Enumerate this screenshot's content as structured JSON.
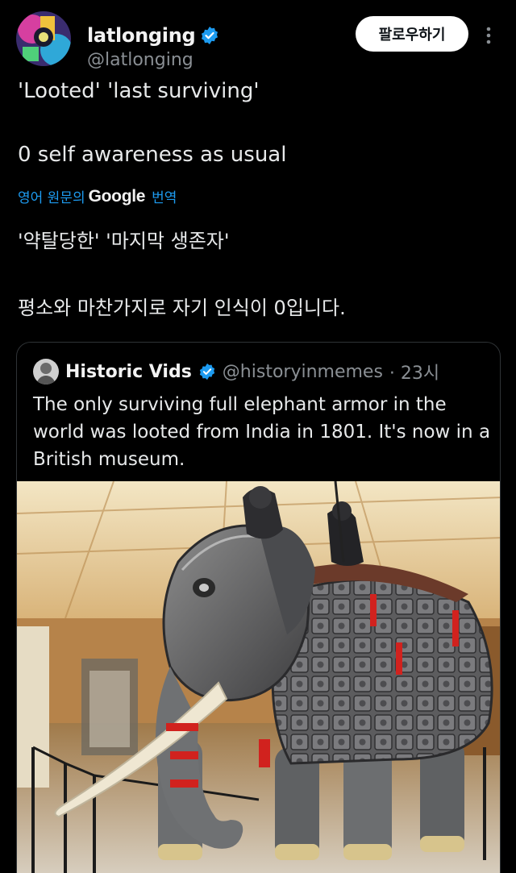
{
  "author": {
    "name": "latlonging",
    "handle": "@latlonging",
    "verified": true,
    "follow_label": "팔로우하기"
  },
  "tweet": {
    "lines": [
      "'Looted' 'last surviving'",
      "0 self awareness as usual"
    ],
    "translate": {
      "prefix": "영어 원문의",
      "brand": "Google",
      "suffix": "번역"
    },
    "translation_lines": [
      "'약탈당한' '마지막 생존자'",
      "평소와 마찬가지로 자기 인식이 0입니다."
    ]
  },
  "quote": {
    "name": "Historic Vids",
    "handle": "@historyinmemes",
    "time": "· 23시",
    "verified": true,
    "lines": [
      "The only surviving full elephant armor in the",
      "world was looted from India in 1801. It's now in a",
      "British museum."
    ]
  },
  "colors": {
    "background": "#000000",
    "text": "#e7e9ea",
    "secondary": "#8a8f94",
    "link": "#1d9bf0",
    "verified": "#1d9bf0"
  }
}
